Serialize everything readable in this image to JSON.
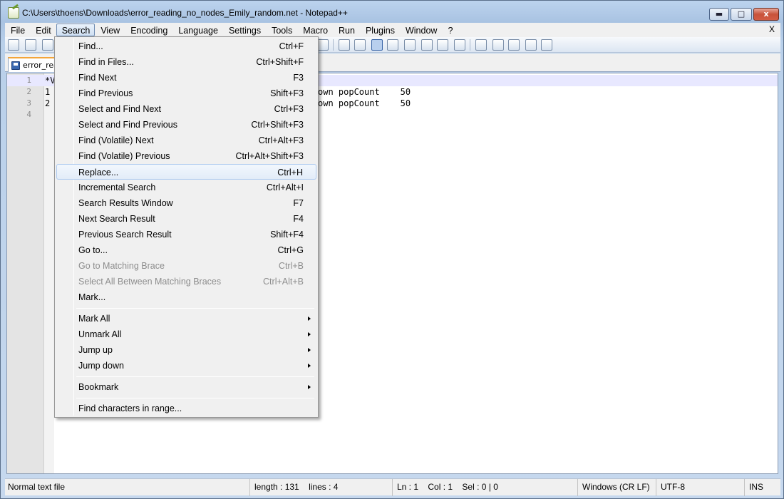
{
  "window": {
    "title": "C:\\Users\\thoens\\Downloads\\error_reading_no_nodes_Emily_random.net - Notepad++",
    "min_label": "",
    "max_label": "",
    "close_label": "x"
  },
  "menubar": {
    "items": [
      "File",
      "Edit",
      "Search",
      "View",
      "Encoding",
      "Language",
      "Settings",
      "Tools",
      "Macro",
      "Run",
      "Plugins",
      "Window",
      "?"
    ],
    "active": "Search",
    "close_doc": "X"
  },
  "tab": {
    "label": "error_reading_no_nodes_Emily_random.net"
  },
  "editor": {
    "lines": [
      {
        "number": "1",
        "text": "*V",
        "right": ""
      },
      {
        "number": "2",
        "text": "1",
        "right": "own popCount    50"
      },
      {
        "number": "3",
        "text": "2",
        "right": "own popCount    50"
      },
      {
        "number": "4",
        "text": "",
        "right": ""
      }
    ]
  },
  "search_menu": {
    "items": [
      {
        "label": "Find...",
        "shortcut": "Ctrl+F"
      },
      {
        "label": "Find in Files...",
        "shortcut": "Ctrl+Shift+F"
      },
      {
        "label": "Find Next",
        "shortcut": "F3"
      },
      {
        "label": "Find Previous",
        "shortcut": "Shift+F3"
      },
      {
        "label": "Select and Find Next",
        "shortcut": "Ctrl+F3"
      },
      {
        "label": "Select and Find Previous",
        "shortcut": "Ctrl+Shift+F3"
      },
      {
        "label": "Find (Volatile) Next",
        "shortcut": "Ctrl+Alt+F3"
      },
      {
        "label": "Find (Volatile) Previous",
        "shortcut": "Ctrl+Alt+Shift+F3"
      },
      {
        "label": "Replace...",
        "shortcut": "Ctrl+H"
      },
      {
        "label": "Incremental Search",
        "shortcut": "Ctrl+Alt+I"
      },
      {
        "label": "Search Results Window",
        "shortcut": "F7"
      },
      {
        "label": "Next Search Result",
        "shortcut": "F4"
      },
      {
        "label": "Previous Search Result",
        "shortcut": "Shift+F4"
      },
      {
        "label": "Go to...",
        "shortcut": "Ctrl+G"
      },
      {
        "label": "Go to Matching Brace",
        "shortcut": "Ctrl+B"
      },
      {
        "label": "Select All Between Matching Braces",
        "shortcut": "Ctrl+Alt+B"
      },
      {
        "label": "Mark...",
        "shortcut": ""
      },
      {
        "label": "Mark All",
        "shortcut": ""
      },
      {
        "label": "Unmark All",
        "shortcut": ""
      },
      {
        "label": "Jump up",
        "shortcut": ""
      },
      {
        "label": "Jump down",
        "shortcut": ""
      },
      {
        "label": "Bookmark",
        "shortcut": ""
      },
      {
        "label": "Find characters in range...",
        "shortcut": ""
      }
    ]
  },
  "statusbar": {
    "file_type": "Normal text file",
    "length": "length : 131",
    "lines": "lines : 4",
    "ln": "Ln : 1",
    "col": "Col : 1",
    "sel": "Sel : 0 | 0",
    "eol": "Windows (CR LF)",
    "encoding": "UTF-8",
    "mode": "INS"
  }
}
